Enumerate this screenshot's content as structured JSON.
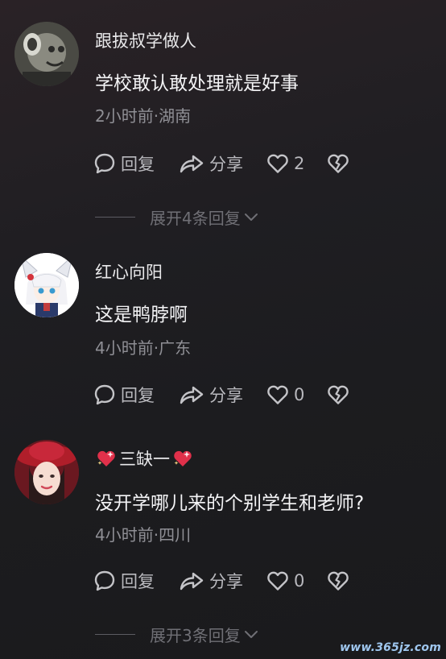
{
  "comments": [
    {
      "username": "跟拔叔学做人",
      "text": "学校敢认敢处理就是好事",
      "meta": "2小时前·湖南",
      "reply_label": "回复",
      "share_label": "分享",
      "likes": "2",
      "expand_label": "展开4条回复"
    },
    {
      "username": "红心向阳",
      "text": "这是鸭脖啊",
      "meta": "4小时前·广东",
      "reply_label": "回复",
      "share_label": "分享",
      "likes": "0"
    },
    {
      "username": "三缺一",
      "text": "没开学哪儿来的个别学生和老师?",
      "meta": "4小时前·四川",
      "reply_label": "回复",
      "share_label": "分享",
      "likes": "0",
      "expand_label": "展开3条回复"
    }
  ],
  "watermark": "www.365jz.com",
  "colors": {
    "background": "#1f1e22",
    "primary_text": "#f4f4f6",
    "secondary_text": "#8f8f95",
    "action_text": "#b9b9be",
    "heart_emoji": "#e0304a"
  },
  "icons": {
    "reply": "speech-bubble-icon",
    "share": "share-arrow-icon",
    "like": "heart-outline-icon",
    "dislike": "broken-heart-icon",
    "expand": "chevron-down-icon",
    "username_decoration": "sparkling-heart-emoji-icon"
  }
}
